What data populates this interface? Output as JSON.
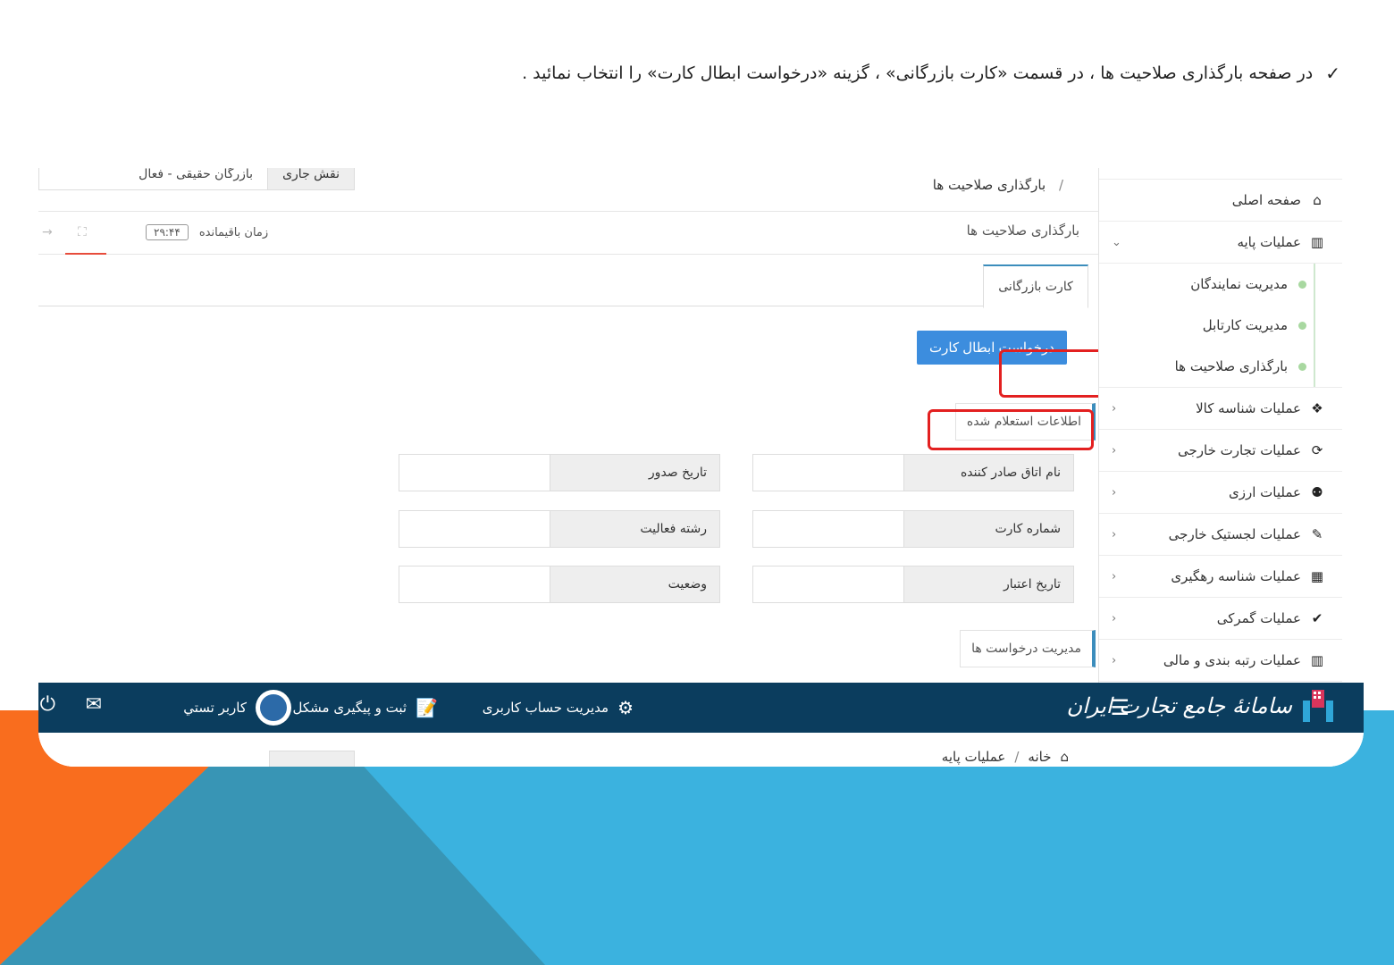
{
  "instruction": {
    "text": "در صفحه بارگذاری صلاحیت ها ، در قسمت «کارت بازرگانی» ، گزینه «درخواست ابطال کارت» را انتخاب نمائید ."
  },
  "header": {
    "breadcrumb_current": "بارگذاری صلاحیت ها",
    "role_label": "نقش جاری",
    "role_value": "بازرگان حقیقی - فعال"
  },
  "titlebar": {
    "page_title": "بارگذاری صلاحیت ها",
    "timer_label": "زمان باقیمانده",
    "timer_value": "۲۹:۴۴"
  },
  "tabs": [
    {
      "label": "کارت بازرگانی"
    }
  ],
  "actions": {
    "cancel_card_button": "درخواست ابطال کارت"
  },
  "sections": {
    "inquired_info": "اطلاعات استعلام شده",
    "request_management": "مدیریت درخواست ها"
  },
  "fields": {
    "issuing_chamber": "نام اتاق صادر کننده",
    "issue_date": "تاریخ صدور",
    "card_number": "شماره کارت",
    "activity_field": "رشته فعالیت",
    "validity_date": "تاریخ اعتبار",
    "status": "وضعیت"
  },
  "sidebar": {
    "items": [
      {
        "label": "صفحه اصلی",
        "icon": "home-icon"
      },
      {
        "label": "عملیات پایه",
        "icon": "bar-chart-icon"
      },
      {
        "label": "عملیات شناسه کالا",
        "icon": "cubes-icon"
      },
      {
        "label": "عملیات تجارت خارجی",
        "icon": "refresh-icon"
      },
      {
        "label": "عملیات ارزی",
        "icon": "user-plus-icon"
      },
      {
        "label": "عملیات لجستیک خارجی",
        "icon": "edit-icon"
      },
      {
        "label": "عملیات شناسه رهگیری",
        "icon": "qrcode-icon"
      },
      {
        "label": "عملیات گمرکی",
        "icon": "check-icon"
      },
      {
        "label": "عملیات رتبه بندی و مالی",
        "icon": "bar-chart-icon"
      }
    ],
    "subitems": [
      {
        "label": "مدیریت نمایندگان"
      },
      {
        "label": "مدیریت کارتابل"
      },
      {
        "label": "بارگذاری صلاحیت ها"
      }
    ]
  },
  "navbar": {
    "brand": "سامانهٔ جامع تجارت ایران",
    "account_management": "مدیریت حساب کاربری",
    "issue_tracking": "ثبت و پیگیری مشکل",
    "user_name": "كاربر تستي"
  },
  "footer_breadcrumb": {
    "home": "خانه",
    "current": "عملیات پایه"
  },
  "colors": {
    "navbar": "#0b3d5e",
    "primary_button": "#3c8dde",
    "highlight": "#e32020",
    "bg_blue": "#3bb2df",
    "bg_orange": "#f96d1e"
  }
}
